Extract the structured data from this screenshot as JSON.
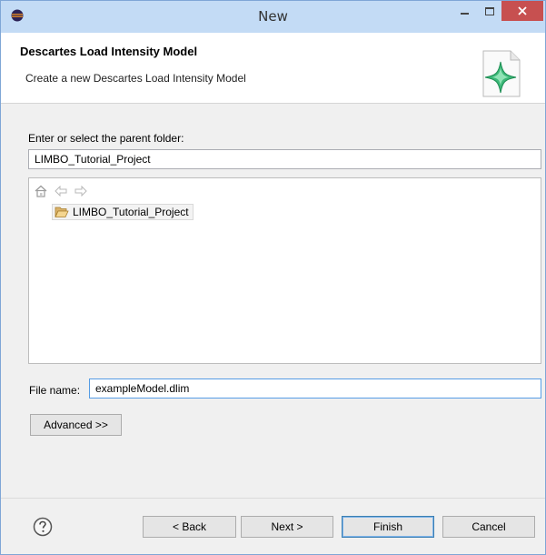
{
  "window": {
    "title": "New"
  },
  "header": {
    "title": "Descartes Load Intensity Model",
    "description": "Create a new Descartes Load Intensity Model"
  },
  "parent_folder": {
    "label": "Enter or select the parent folder:",
    "value": "LIMBO_Tutorial_Project"
  },
  "tree": {
    "items": [
      {
        "label": "LIMBO_Tutorial_Project",
        "icon": "open-folder-icon"
      }
    ],
    "toolbar_icons": [
      "home-icon",
      "back-arrow-icon",
      "forward-arrow-icon"
    ]
  },
  "file_name": {
    "label": "File name:",
    "value": "exampleModel.dlim"
  },
  "buttons": {
    "advanced": "Advanced >>",
    "back": "< Back",
    "next": "Next >",
    "finish": "Finish",
    "cancel": "Cancel"
  },
  "colors": {
    "titlebar": "#c3dbf5",
    "close_button": "#c75050",
    "default_button_border": "#3c7fb1",
    "wizard_star": "#3cb878"
  }
}
